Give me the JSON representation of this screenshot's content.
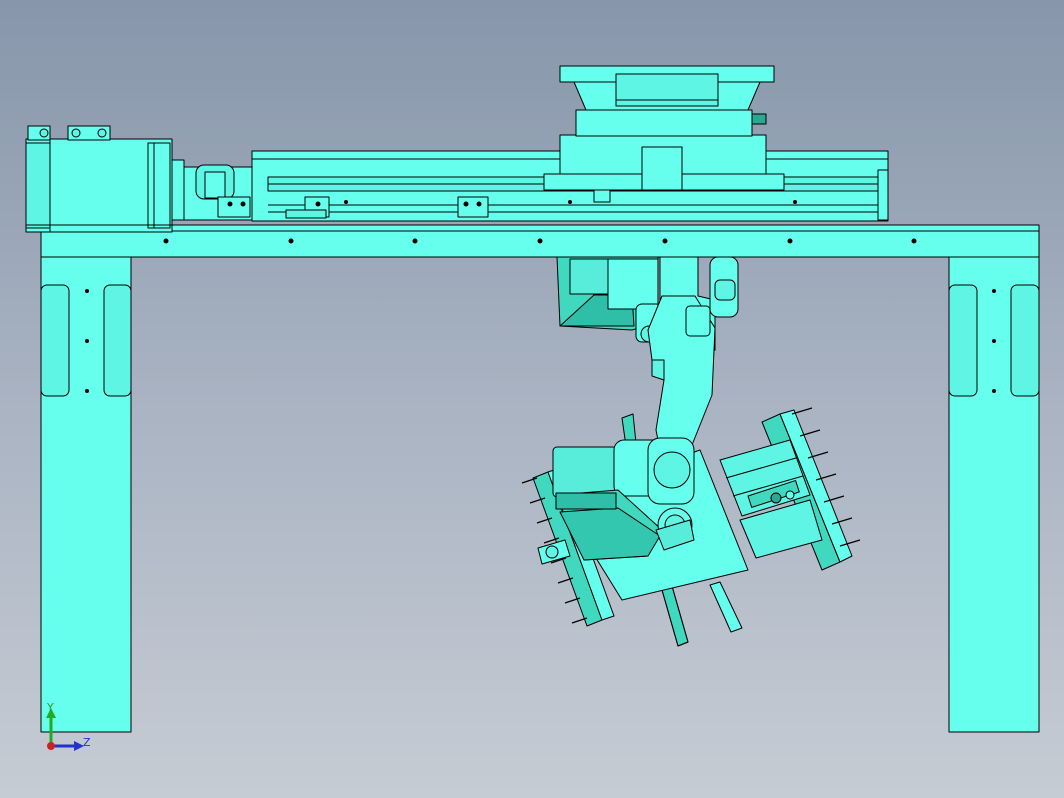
{
  "viewport": {
    "background_top": "#8796ab",
    "background_bottom": "#c6ccd4",
    "part_color": "#66ffee",
    "part_shade": "#40d9c0",
    "part_dark": "#2aa890",
    "edge_color": "#000000"
  },
  "triad": {
    "y_label": "Y",
    "z_label": "Z",
    "y_color": "#22aa22",
    "z_color": "#2233cc",
    "origin_color": "#cc2222"
  },
  "model": {
    "components": [
      "servo-motor",
      "linear-rail",
      "top-carriage",
      "gantry-beam",
      "left-leg",
      "right-leg",
      "robot-arm",
      "gripper-fixture"
    ]
  }
}
